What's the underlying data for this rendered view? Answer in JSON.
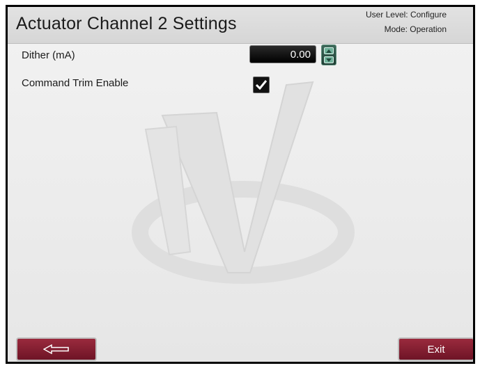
{
  "header": {
    "title": "Actuator Channel 2 Settings",
    "user_level": "User Level: Configure",
    "mode": "Mode: Operation"
  },
  "settings": {
    "dither": {
      "label": "Dither (mA)",
      "value": "0.00"
    },
    "command_trim": {
      "label": "Command Trim Enable",
      "checked": true
    }
  },
  "footer": {
    "back_icon": "left-arrow-icon",
    "exit_label": "Exit"
  },
  "colors": {
    "button": "#8a1f33",
    "spinner": "#2f5a4b",
    "value_bg": "#000000"
  }
}
